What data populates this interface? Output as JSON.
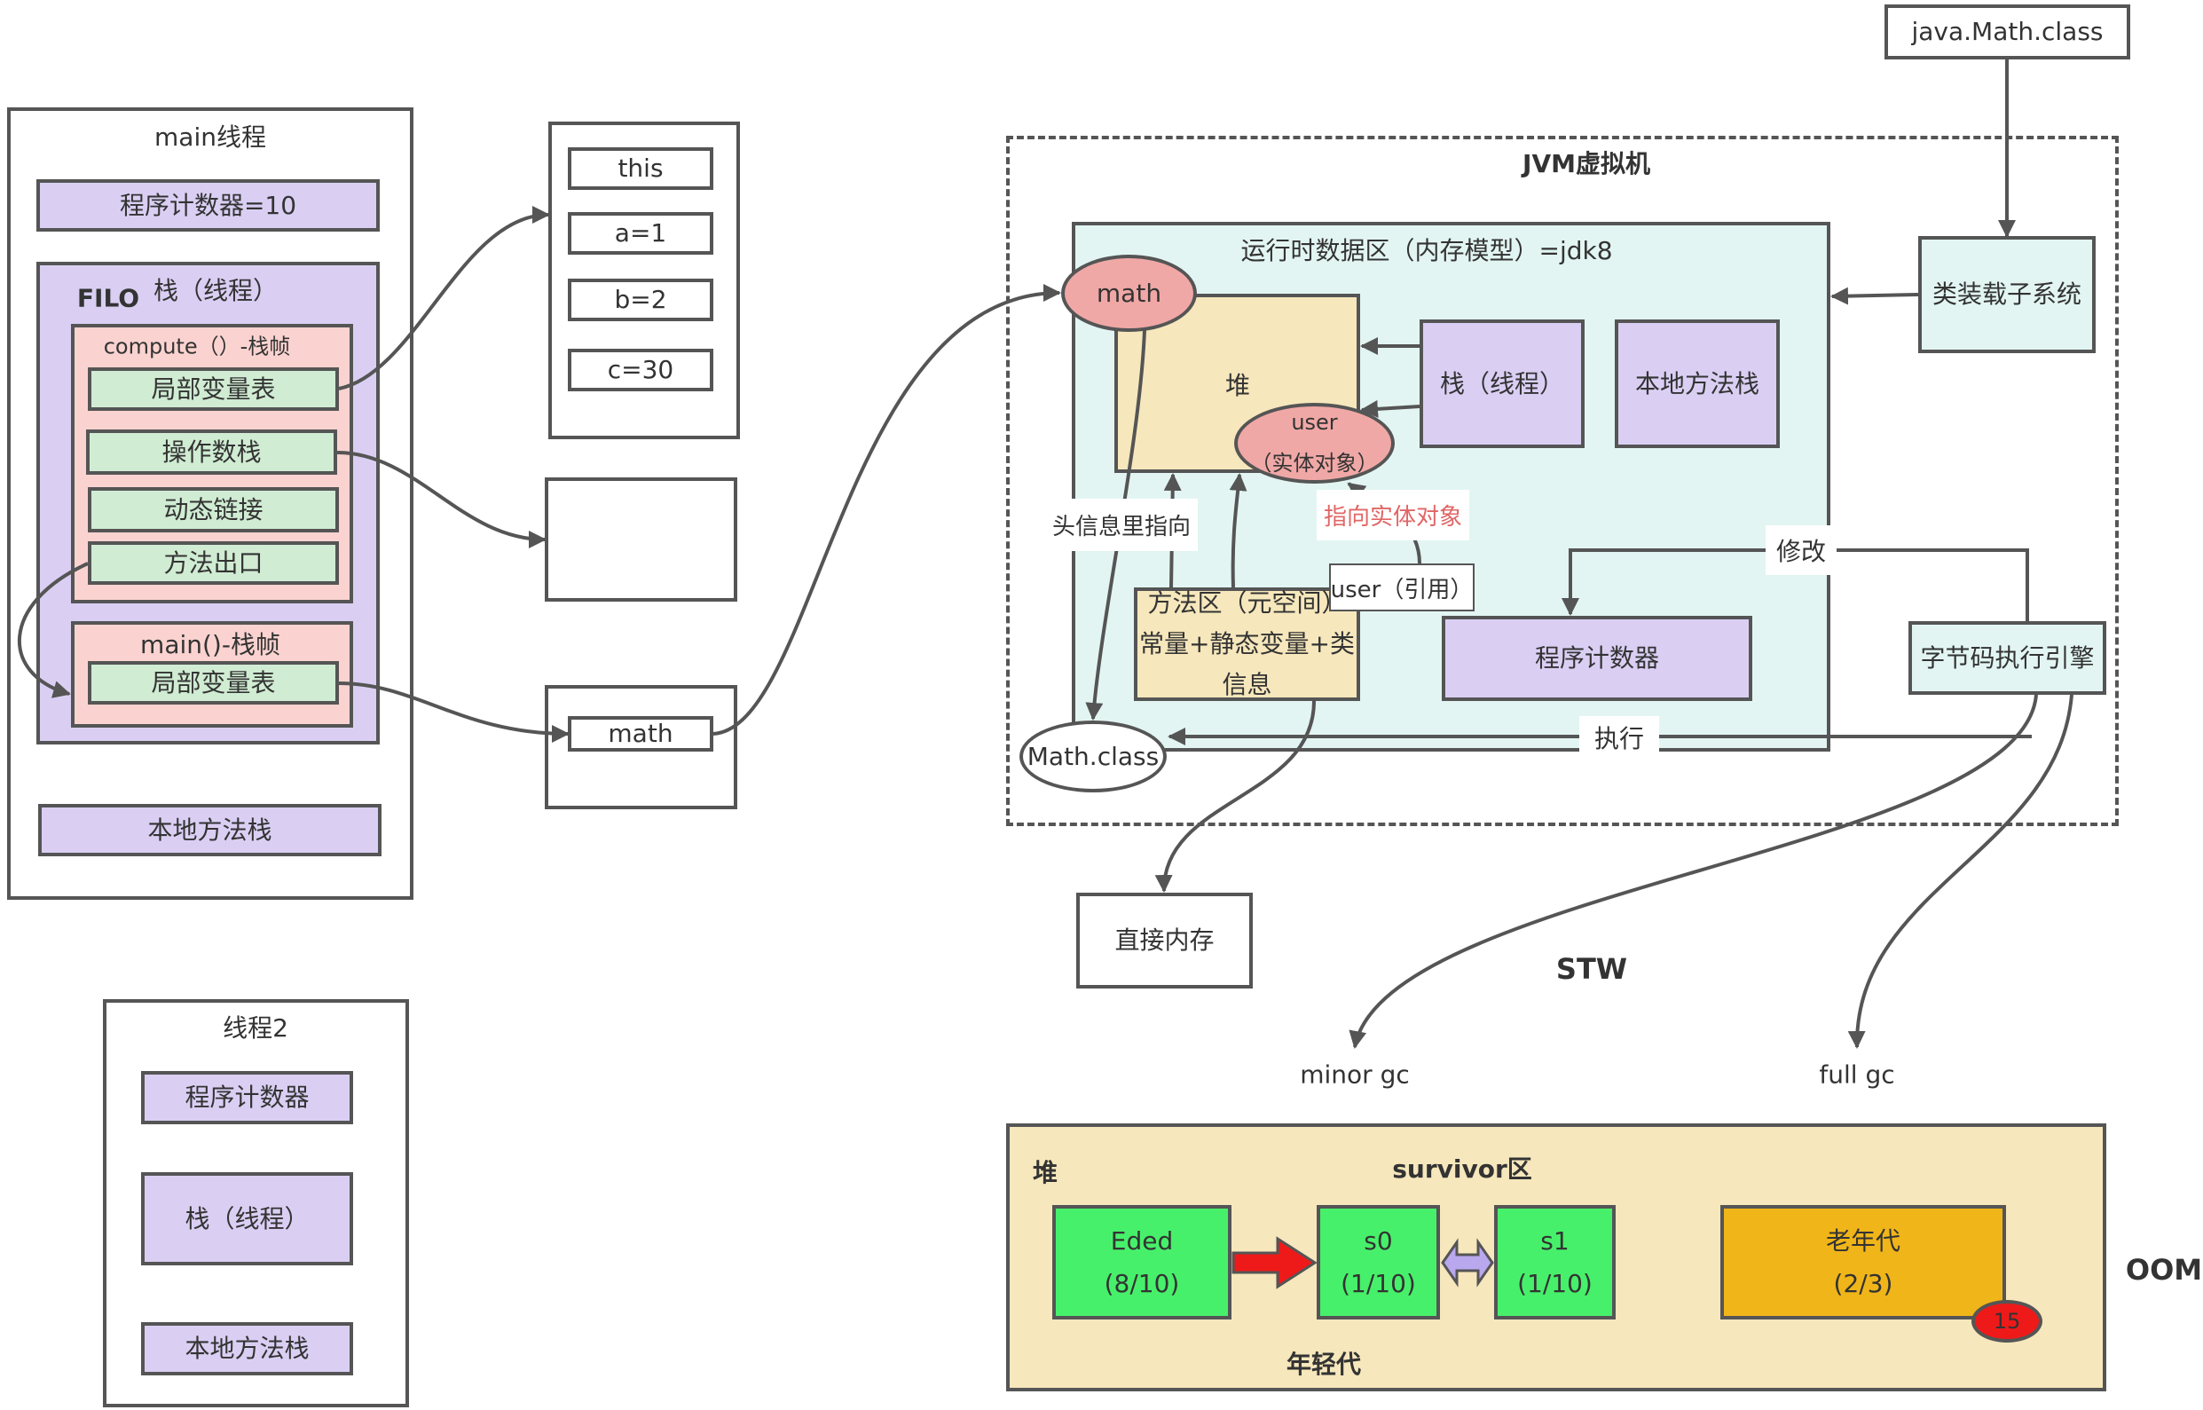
{
  "main_thread": {
    "title": "main线程",
    "program_counter": "程序计数器=10",
    "stack_filo": "FILO",
    "stack_title": "栈（线程）",
    "compute_frame": {
      "title": "compute（）-栈帧",
      "items": [
        "局部变量表",
        "操作数栈",
        "动态链接",
        "方法出口"
      ]
    },
    "main_frame": {
      "title": "main()-栈帧",
      "items": [
        "局部变量表"
      ]
    },
    "native_stack": "本地方法栈"
  },
  "thread2": {
    "title": "线程2",
    "program_counter": "程序计数器",
    "stack": "栈（线程）",
    "native_stack": "本地方法栈"
  },
  "locals": [
    "this",
    "a=1",
    "b=2",
    "c=30"
  ],
  "math_ref": "math",
  "class_file": "java.Math.class",
  "jvm": {
    "title": "JVM虚拟机",
    "runtime_title": "运行时数据区（内存模型）=jdk8",
    "math_obj": "math",
    "heap": "堆",
    "user_obj": [
      "user",
      "（实体对象）"
    ],
    "stack": "栈（线程）",
    "native_stack": "本地方法栈",
    "method_area": [
      "方法区（元空间）",
      "常量+静态变量+类",
      "信息"
    ],
    "user_ref": "user（引用）",
    "points_to_entity": "指向实体对象",
    "header_points": "头信息里指向",
    "program_counter": "程序计数器",
    "modify": "修改",
    "execute": "执行",
    "math_class": "Math.class",
    "class_loader": "类装载子系统",
    "bytecode_engine": "字节码执行引擎"
  },
  "direct_memory": "直接内存",
  "stw": "STW",
  "minor_gc": "minor gc",
  "full_gc": "full gc",
  "heap_detail": {
    "title": "堆",
    "survivor": "survivor区",
    "young_gen": "年轻代",
    "eden": [
      "Eded",
      "(8/10)"
    ],
    "s0": [
      "s0",
      "(1/10)"
    ],
    "s1": [
      "s1",
      "(1/10)"
    ],
    "old_gen": [
      "老年代",
      "(2/3)"
    ],
    "age_badge": "15",
    "oom": "OOM"
  },
  "colors": {
    "purple": "#dacff3",
    "green": "#d0ecd3",
    "pink": "#fad3d0",
    "cream": "#f6e7bc",
    "teal": "#e2f5f2",
    "bright_green": "#47f06a",
    "old_gen": "#f0b519",
    "object_red": "#f0a8a6",
    "badge_red": "#ee1a1a",
    "label_red": "#e06666"
  }
}
